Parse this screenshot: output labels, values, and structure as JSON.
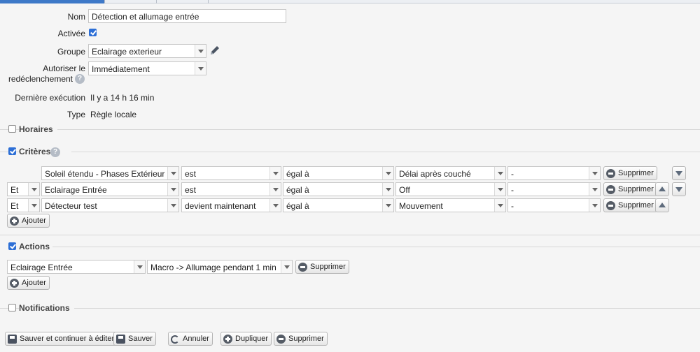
{
  "form": {
    "nom_label": "Nom",
    "nom_value": "Détection et allumage entrée",
    "activee_label": "Activée",
    "groupe_label": "Groupe",
    "groupe_value": "Eclairage exterieur",
    "autoriser_label_1": "Autoriser le",
    "autoriser_label_2": "redéclenchement",
    "autoriser_value": "Immédiatement",
    "derniere_label": "Dernière exécution",
    "derniere_value": "Il y a 14 h 16 min",
    "type_label": "Type",
    "type_value": "Règle locale"
  },
  "sections": {
    "horaires": "Horaires",
    "criteres": "Critères",
    "actions": "Actions",
    "notifications": "Notifications"
  },
  "criteria": [
    {
      "conj": "",
      "device": "Soleil étendu - Phases Extérieur",
      "verb": "est",
      "comp": "égal à",
      "value": "Délai après couché",
      "extra": "-"
    },
    {
      "conj": "Et",
      "device": "Eclairage Entrée",
      "verb": "est",
      "comp": "égal à",
      "value": "Off",
      "extra": "-"
    },
    {
      "conj": "Et",
      "device": "Détecteur test",
      "verb": "devient maintenant",
      "comp": "égal à",
      "value": "Mouvement",
      "extra": "-"
    }
  ],
  "action": {
    "device": "Eclairage Entrée",
    "command": "Macro -> Allumage pendant 1 min"
  },
  "buttons": {
    "supprimer": "Supprimer",
    "ajouter": "Ajouter",
    "save_continue": "Sauver et continuer à éditer",
    "save": "Sauver",
    "cancel": "Annuler",
    "duplicate": "Dupliquer",
    "delete": "Supprimer"
  },
  "help_glyph": "?",
  "colors": {
    "accent": "#2d6fd6",
    "tab_active": "#3e79c8"
  }
}
